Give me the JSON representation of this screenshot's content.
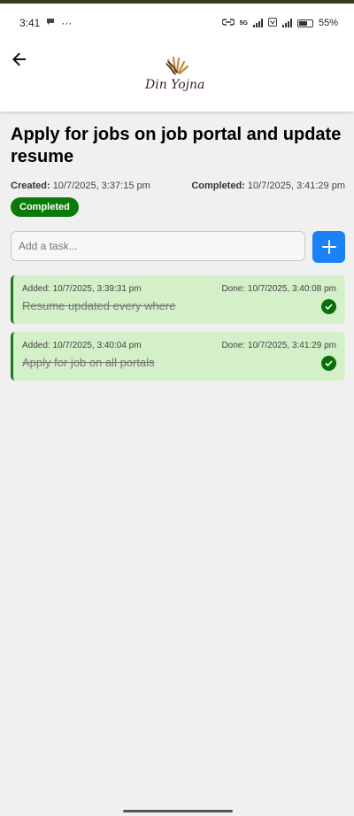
{
  "status_bar": {
    "time": "3:41",
    "dots": "···",
    "network": "5G",
    "battery": "55%"
  },
  "app": {
    "logo_text": "Din Yojna"
  },
  "project": {
    "title": "Apply for jobs on job portal and update resume",
    "created_label": "Created:",
    "created_value": "10/7/2025, 3:37:15 pm",
    "completed_label": "Completed:",
    "completed_value": "10/7/2025, 3:41:29 pm",
    "status": "Completed"
  },
  "add_task": {
    "placeholder": "Add a task..."
  },
  "tasks": [
    {
      "added": "Added: 10/7/2025, 3:39:31 pm",
      "done": "Done: 10/7/2025, 3:40:08 pm",
      "text": "Resume updated every where"
    },
    {
      "added": "Added: 10/7/2025, 3:40:04 pm",
      "done": "Done: 10/7/2025, 3:41:29 pm",
      "text": "Apply for job on all portals"
    }
  ],
  "colors": {
    "accent": "#1a82f5",
    "completed": "#0a7a0a",
    "task_bg": "#d4f0c8"
  }
}
